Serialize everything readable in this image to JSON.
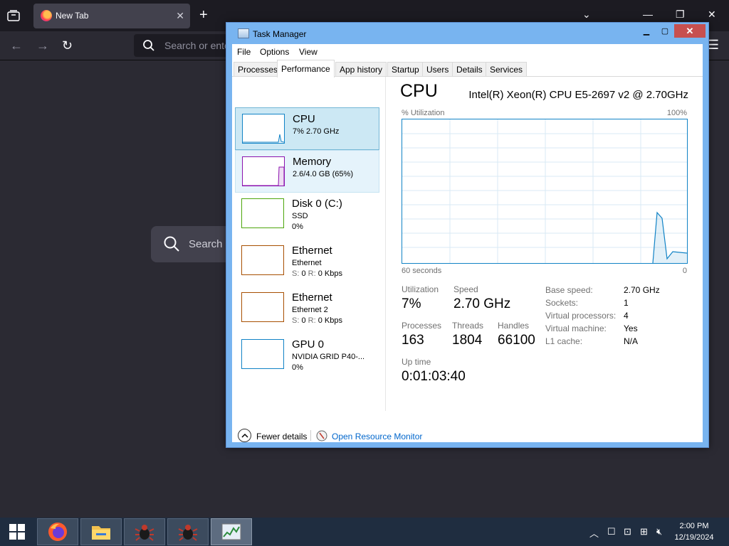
{
  "browser": {
    "tab_title": "New Tab",
    "url_placeholder": "Search or ente",
    "content_search_placeholder": "Search o"
  },
  "task_manager": {
    "title": "Task Manager",
    "menu": [
      "File",
      "Options",
      "View"
    ],
    "tabs": [
      "Processes",
      "Performance",
      "App history",
      "Startup",
      "Users",
      "Details",
      "Services"
    ],
    "active_tab": "Performance",
    "resources": [
      {
        "name": "CPU",
        "line2": "7%  2.70 GHz",
        "line3": "",
        "color": "#1183c6"
      },
      {
        "name": "Memory",
        "line2": "2.6/4.0 GB (65%)",
        "line3": "",
        "color": "#8b12ae"
      },
      {
        "name": "Disk 0 (C:)",
        "line2": "SSD",
        "line3": "0%",
        "color": "#4da60c"
      },
      {
        "name": "Ethernet",
        "line2": "Ethernet",
        "line3_prefix_s": "S:",
        "line3_s": "0",
        "line3_prefix_r": "R:",
        "line3_r": "0 Kbps",
        "color": "#a74f01"
      },
      {
        "name": "Ethernet",
        "line2": "Ethernet 2",
        "line3_prefix_s": "S:",
        "line3_s": "0",
        "line3_prefix_r": "R:",
        "line3_r": "0 Kbps",
        "color": "#a74f01"
      },
      {
        "name": "GPU 0",
        "line2": "NVIDIA GRID P40-...",
        "line3": "0%",
        "color": "#1183c6"
      }
    ],
    "cpu": {
      "title": "CPU",
      "model": "Intel(R) Xeon(R) CPU E5-2697 v2 @ 2.70GHz",
      "util_label": "% Utilization",
      "util_max": "100%",
      "time_label": "60 seconds",
      "time_zero": "0",
      "stats": {
        "utilization_label": "Utilization",
        "utilization": "7%",
        "speed_label": "Speed",
        "speed": "2.70 GHz",
        "processes_label": "Processes",
        "processes": "163",
        "threads_label": "Threads",
        "threads": "1804",
        "handles_label": "Handles",
        "handles": "66100",
        "uptime_label": "Up time",
        "uptime": "0:01:03:40"
      },
      "details": [
        {
          "k": "Base speed:",
          "v": "2.70 GHz"
        },
        {
          "k": "Sockets:",
          "v": "1"
        },
        {
          "k": "Virtual processors:",
          "v": "4"
        },
        {
          "k": "Virtual machine:",
          "v": "Yes"
        },
        {
          "k": "L1 cache:",
          "v": "N/A"
        }
      ]
    },
    "footer": {
      "fewer_details": "Fewer details",
      "open_resource_monitor": "Open Resource Monitor"
    }
  },
  "taskbar": {
    "time": "2:00 PM",
    "date": "12/19/2024"
  }
}
